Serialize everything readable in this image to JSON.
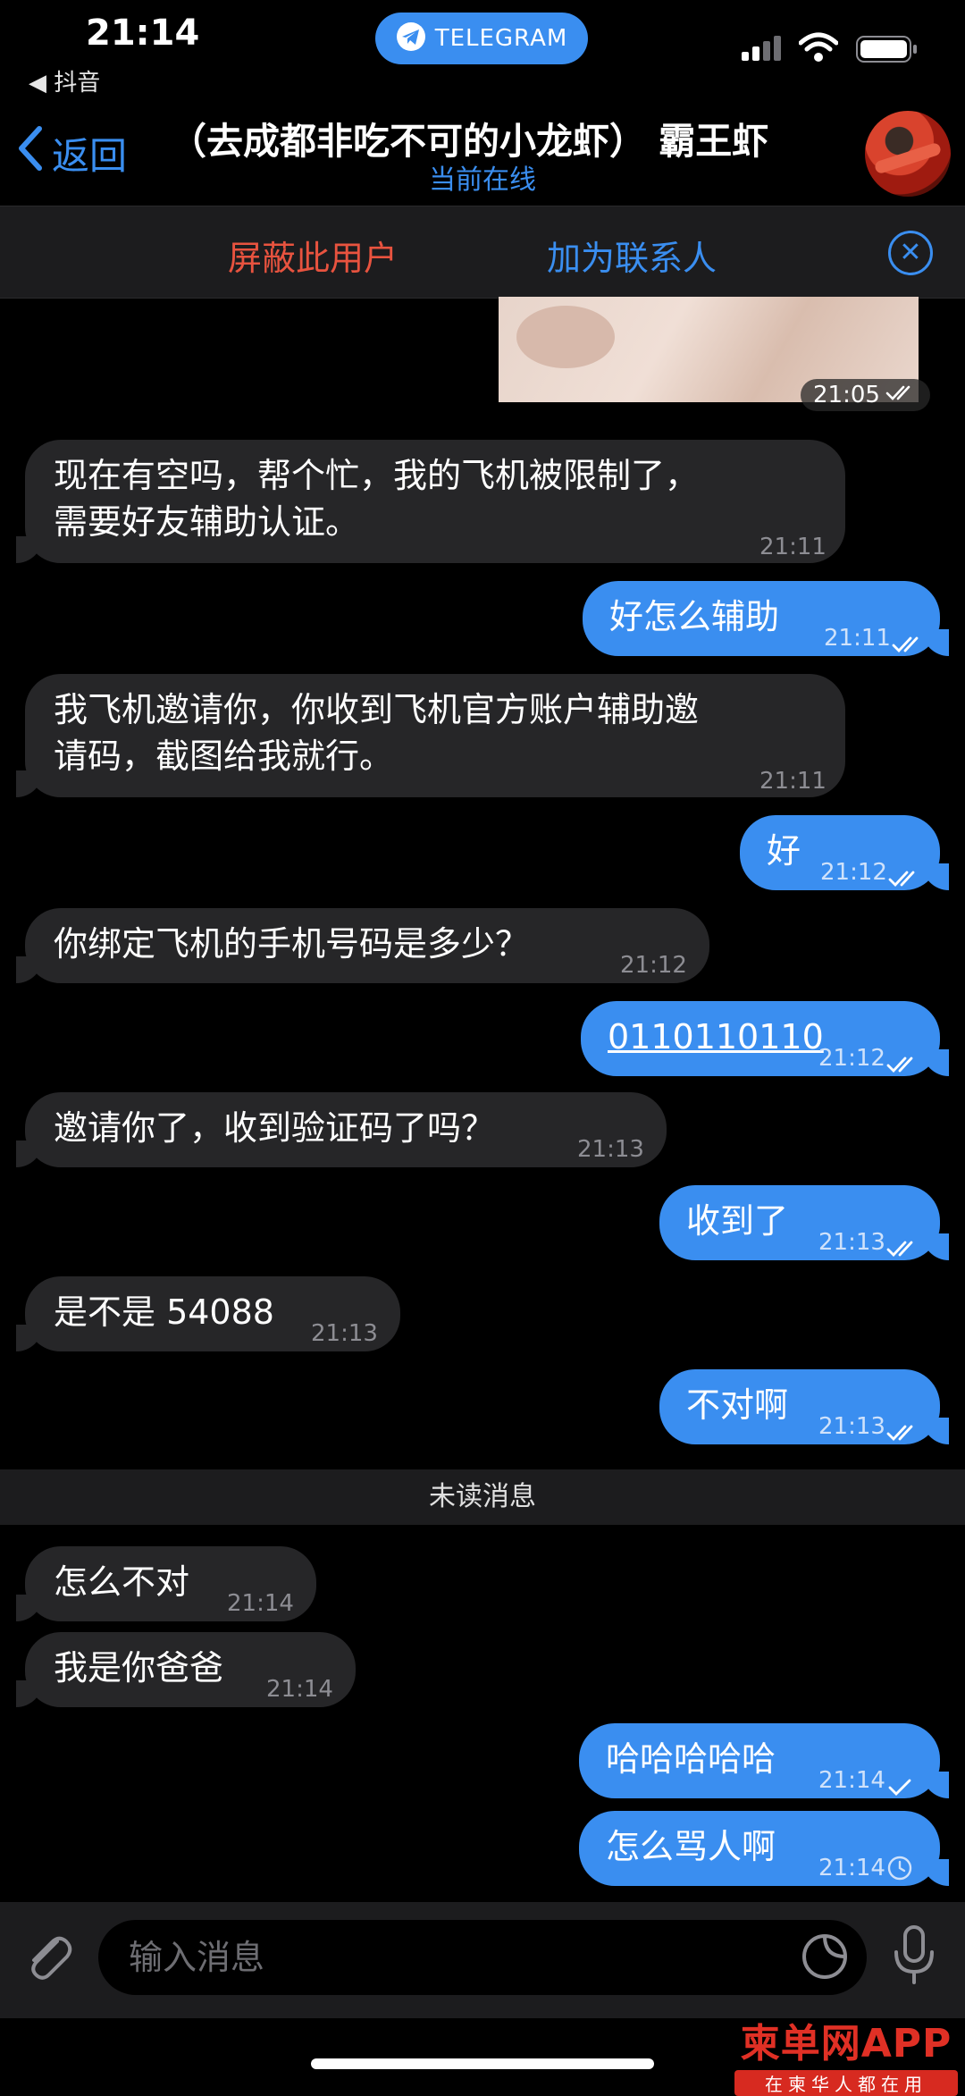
{
  "status_bar": {
    "time": "21:14",
    "back_app": "◀ 抖音",
    "pill_label": "TELEGRAM"
  },
  "header": {
    "back_label": "返回",
    "title": "（去成都非吃不可的小龙虾） 霸王虾",
    "status": "当前在线"
  },
  "action_bar": {
    "block_label": "屏蔽此用户",
    "add_contact_label": "加为联系人"
  },
  "photo_time": "21:05",
  "messages": [
    {
      "dir": "in",
      "lines": [
        "现在有空吗，帮个忙，我的飞机被限制了，",
        "需要好友辅助认证。"
      ],
      "time": "21:11"
    },
    {
      "dir": "out",
      "lines": [
        "好怎么辅助"
      ],
      "time": "21:11",
      "status": "read"
    },
    {
      "dir": "in",
      "lines": [
        "我飞机邀请你，你收到飞机官方账户辅助邀",
        "请码，截图给我就行。"
      ],
      "time": "21:11"
    },
    {
      "dir": "out",
      "lines": [
        "好"
      ],
      "time": "21:12",
      "status": "read"
    },
    {
      "dir": "in",
      "lines": [
        "你绑定飞机的手机号码是多少？"
      ],
      "time": "21:12"
    },
    {
      "dir": "out",
      "lines": [
        "0110110110"
      ],
      "time": "21:12",
      "status": "read",
      "link": true
    },
    {
      "dir": "in",
      "lines": [
        "邀请你了，收到验证码了吗？"
      ],
      "time": "21:13"
    },
    {
      "dir": "out",
      "lines": [
        "收到了"
      ],
      "time": "21:13",
      "status": "read"
    },
    {
      "dir": "in",
      "lines": [
        "是不是 54088"
      ],
      "time": "21:13"
    },
    {
      "dir": "out",
      "lines": [
        "不对啊"
      ],
      "time": "21:13",
      "status": "read"
    },
    {
      "dir": "in",
      "lines": [
        "怎么不对"
      ],
      "time": "21:14"
    },
    {
      "dir": "in",
      "lines": [
        "我是你爸爸"
      ],
      "time": "21:14"
    },
    {
      "dir": "out",
      "lines": [
        "哈哈哈哈哈"
      ],
      "time": "21:14",
      "status": "sent"
    },
    {
      "dir": "out",
      "lines": [
        "怎么骂人啊"
      ],
      "time": "21:14",
      "status": "pending"
    }
  ],
  "unread_label": "未读消息",
  "input": {
    "placeholder": "输入消息"
  },
  "watermark": {
    "brand": "柬单网APP",
    "tagline": "在柬华人都在用"
  },
  "colors": {
    "accent": "#3a8ef0",
    "danger": "#e8533f",
    "incoming_bubble": "#262628",
    "outgoing_bubble": "#3a8ef0",
    "background": "#000000"
  },
  "icons": [
    "telegram-icon",
    "signal-icon",
    "wifi-icon",
    "battery-icon",
    "chevron-left-icon",
    "close-circle-icon",
    "double-check-icon",
    "single-check-icon",
    "clock-icon",
    "paperclip-icon",
    "sticker-icon",
    "microphone-icon"
  ]
}
